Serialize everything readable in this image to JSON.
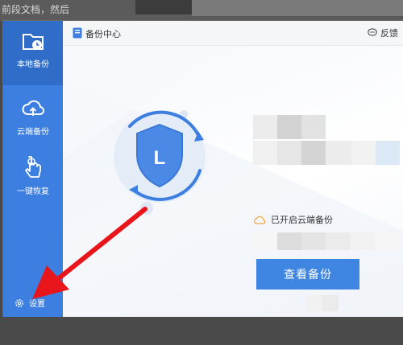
{
  "background": {
    "snippet": "前段文档，然后"
  },
  "sidebar": {
    "items": [
      {
        "label": "本地备份",
        "icon": "folder-clock-icon"
      },
      {
        "label": "云端备份",
        "icon": "cloud-upload-icon"
      },
      {
        "label": "一键恢复",
        "icon": "hand-tap-icon"
      }
    ],
    "settings_label": "设置"
  },
  "titlebar": {
    "title": "备份中心",
    "feedback_label": "反馈"
  },
  "main": {
    "shield_letter": "L",
    "cloud_status": "已开启云端备份",
    "view_button": "查看备份"
  },
  "colors": {
    "accent": "#3d7fe0",
    "button": "#3f86e3",
    "arrow": "#e8161b"
  }
}
